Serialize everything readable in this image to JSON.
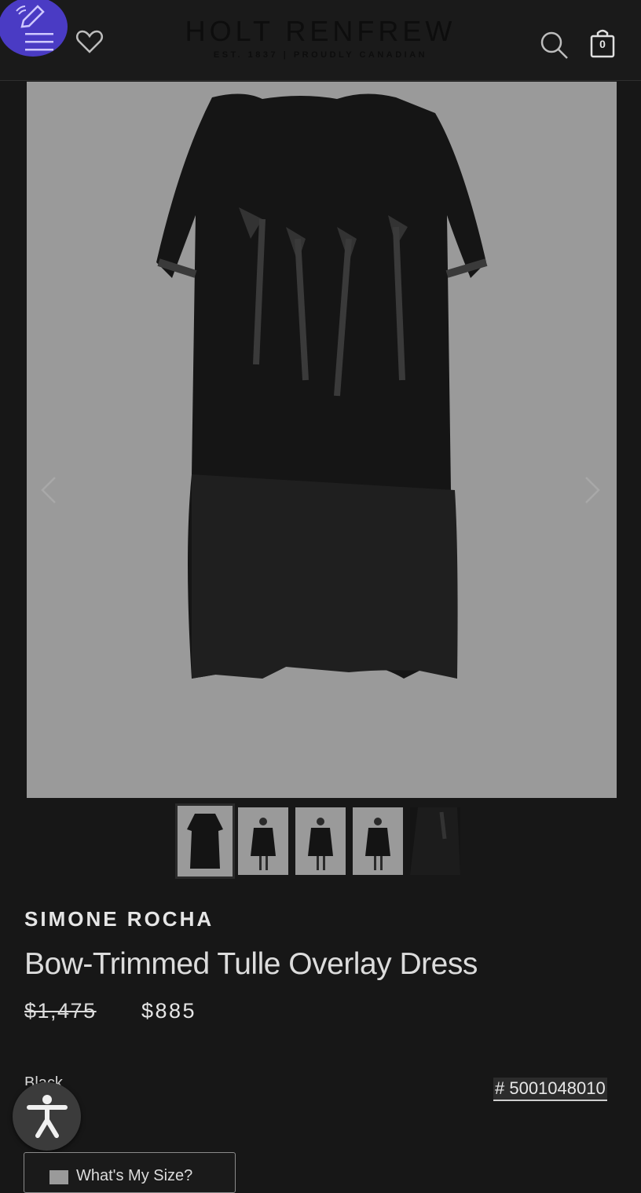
{
  "header": {
    "brand_name": "HOLT RENFREW",
    "brand_tagline": "EST. 1837 | PROUDLY CANADIAN",
    "bag_count": "0",
    "icons": [
      "pencil-icon",
      "menu-icon",
      "heart-icon",
      "search-icon",
      "shopping-bag-icon"
    ]
  },
  "gallery": {
    "thumbnail_count": 5,
    "active_index": 0
  },
  "product": {
    "designer": "SIMONE ROCHA",
    "title": "Bow-Trimmed Tulle Overlay Dress",
    "original_price": "$1,475",
    "sale_price": "$885",
    "color_label": "Black",
    "sku": "# 5001048010"
  },
  "size_button": {
    "label": "What's My Size?"
  },
  "colors": {
    "background": "#171717",
    "header": "#1a1a1a",
    "accent_fab": "#4a3bc4",
    "image_bg": "#9a9a9a"
  }
}
